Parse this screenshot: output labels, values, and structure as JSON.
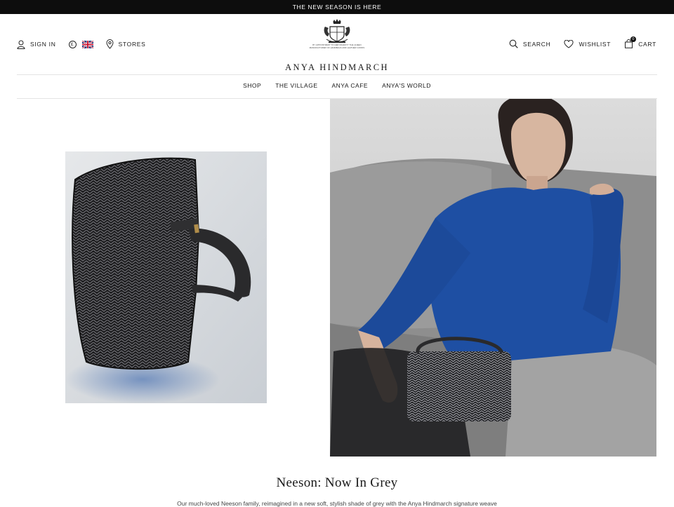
{
  "announcement": "THE NEW SEASON IS HERE",
  "header": {
    "sign_in": "SIGN IN",
    "currency_symbol": "£",
    "stores": "STORES",
    "search": "SEARCH",
    "wishlist": "WISHLIST",
    "cart": "CART",
    "cart_count": "0",
    "crest_text": "BY APPOINTMENT TO HER MAJESTY THE QUEEN MANUFACTURER OF HANDBAGS AND LEATHER GOODS",
    "brand": "ANYA HINDMARCH"
  },
  "nav": {
    "items": [
      "SHOP",
      "THE VILLAGE",
      "ANYA CAFE",
      "ANYA'S WORLD"
    ]
  },
  "feature": {
    "heading": "Neeson: Now In Grey",
    "subtext": "Our much-loved Neeson family, reimagined in a new soft, stylish shade of grey with the Anya Hindmarch signature weave"
  },
  "colors": {
    "announcement_bg": "#0d0d0d",
    "sweater_blue": "#1e4fa3",
    "text": "#1a1a1a"
  }
}
